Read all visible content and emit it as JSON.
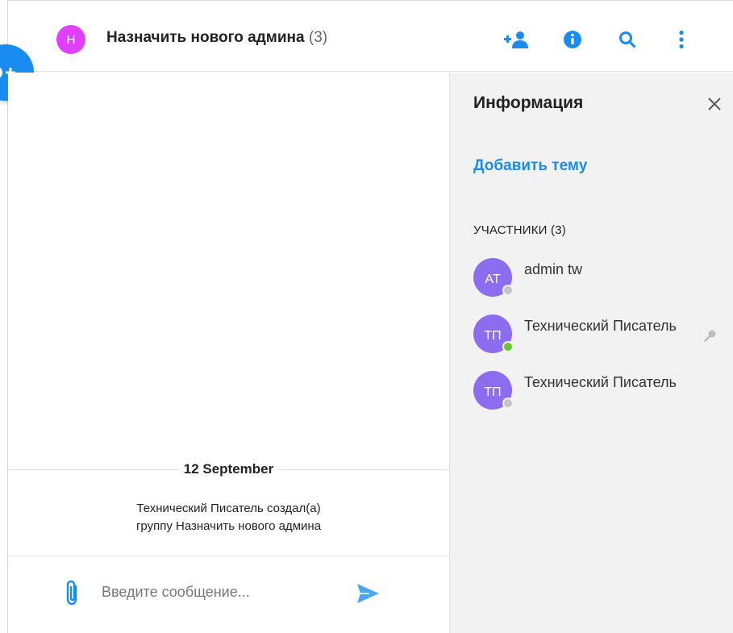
{
  "header": {
    "avatar_letter": "Н",
    "title": "Назначить нового админа",
    "count": "(3)",
    "icons": [
      "add-user-icon",
      "info-icon",
      "search-icon",
      "more-vertical-icon"
    ]
  },
  "fab": {
    "icon": "new-chat-icon"
  },
  "chat": {
    "date": "12 September",
    "system_line1": "Технический Писатель создал(а)",
    "system_line2": "группу Назначить нового админа",
    "composer_placeholder": "Введите сообщение..."
  },
  "side": {
    "title": "Информация",
    "add_topic": "Добавить тему",
    "members_label": "УЧАСТНИКИ (3)",
    "members": [
      {
        "initials": "AT",
        "name": "admin tw",
        "status": "offline"
      },
      {
        "initials": "ТП",
        "name": "Технический Писатель",
        "status": "online",
        "badge": "key-icon"
      },
      {
        "initials": "ТП",
        "name": "Технический Писатель",
        "status": "offline"
      }
    ]
  },
  "colors": {
    "accent": "#1a8cf0",
    "group_avatar": "#e040fb",
    "member_avatar": "#8c6df0",
    "online": "#6ac52e",
    "offline": "#c4c4c4",
    "panel_bg": "#f2f2f2"
  }
}
